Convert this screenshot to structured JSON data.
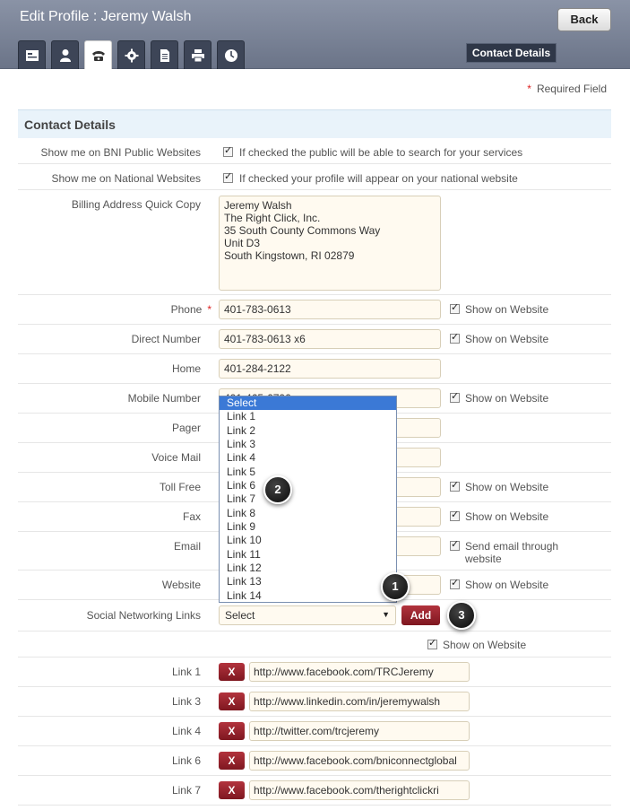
{
  "header": {
    "title": "Edit Profile : Jeremy Walsh",
    "back_label": "Back",
    "section_button": "Contact Details",
    "tabs": [
      {
        "icon": "id-card-icon"
      },
      {
        "icon": "person-icon"
      },
      {
        "icon": "telephone-icon"
      },
      {
        "icon": "gear-icon"
      },
      {
        "icon": "document-icon"
      },
      {
        "icon": "printer-icon"
      },
      {
        "icon": "clock-icon"
      }
    ]
  },
  "required_note": "Required Field",
  "section_title": "Contact Details",
  "fields": {
    "public_sites": {
      "label": "Show me on BNI Public Websites",
      "text": "If checked the public will be able to search for your services"
    },
    "national_sites": {
      "label": "Show me on National Websites",
      "text": "If checked your profile will appear on your national website"
    },
    "billing": {
      "label": "Billing Address Quick Copy",
      "lines": [
        "Jeremy Walsh",
        "The Right Click, Inc.",
        "35 South County Commons Way",
        "Unit D3",
        "South Kingstown, RI 02879"
      ]
    },
    "phone": {
      "label": "Phone",
      "value": "401-783-0613",
      "show": "Show on Website"
    },
    "direct": {
      "label": "Direct Number",
      "value": "401-783-0613 x6",
      "show": "Show on Website"
    },
    "home": {
      "label": "Home",
      "value": "401-284-2122"
    },
    "mobile": {
      "label": "Mobile Number",
      "value": "401-465-6706",
      "show": "Show on Website"
    },
    "pager": {
      "label": "Pager"
    },
    "voicemail": {
      "label": "Voice Mail"
    },
    "tollfree": {
      "label": "Toll Free",
      "show": "Show on Website"
    },
    "fax": {
      "label": "Fax",
      "show": "Show on Website"
    },
    "email": {
      "label": "Email",
      "show_line1": "Send email through",
      "show_line2": "website"
    },
    "website": {
      "label": "Website",
      "show": "Show on Website"
    },
    "social": {
      "label": "Social Networking Links",
      "select_value": "Select",
      "add_label": "Add",
      "show": "Show on Website"
    }
  },
  "dropdown_options": [
    "Select",
    "Link 1",
    "Link 2",
    "Link 3",
    "Link 4",
    "Link 5",
    "Link 6",
    "Link 7",
    "Link 8",
    "Link 9",
    "Link 10",
    "Link 11",
    "Link 12",
    "Link 13",
    "Link 14"
  ],
  "links": [
    {
      "label": "Link 1",
      "url": "http://www.facebook.com/TRCJeremy"
    },
    {
      "label": "Link 3",
      "url": "http://www.linkedin.com/in/jeremywalsh"
    },
    {
      "label": "Link 4",
      "url": "http://twitter.com/trcjeremy"
    },
    {
      "label": "Link 6",
      "url": "http://www.facebook.com/bniconnectglobal"
    },
    {
      "label": "Link 7",
      "url": "http://www.facebook.com/therightclickri"
    }
  ],
  "remove_label": "X",
  "callouts": [
    "1",
    "2",
    "3"
  ]
}
